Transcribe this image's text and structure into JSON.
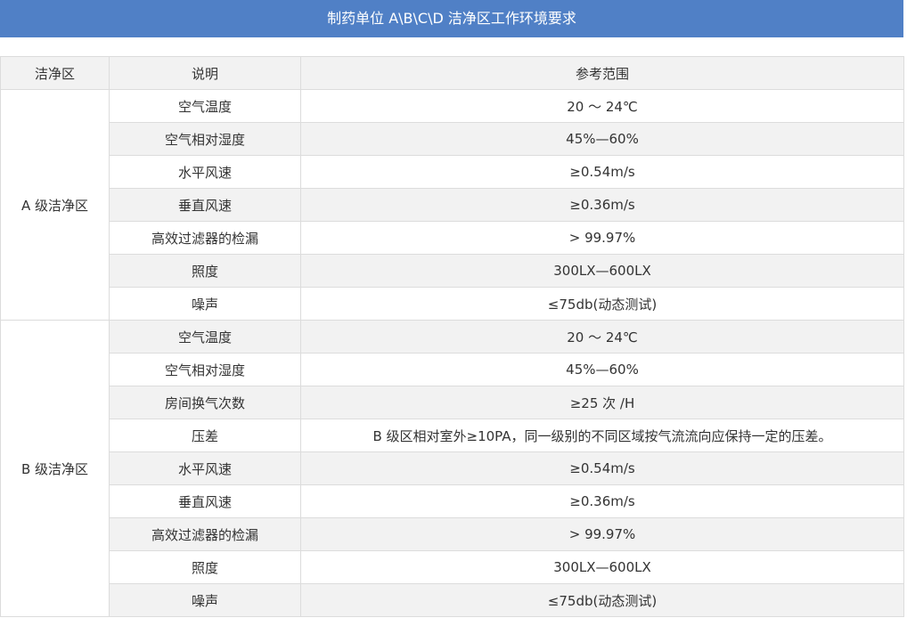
{
  "title": "制药单位 A\\B\\C\\D 洁净区工作环境要求",
  "table": {
    "headers": [
      "洁净区",
      "说明",
      "参考范围"
    ],
    "groups": [
      {
        "zone": "A 级洁净区",
        "rows": [
          {
            "item": "空气温度",
            "range": "20 ～ 24℃"
          },
          {
            "item": "空气相对湿度",
            "range": "45%—60%"
          },
          {
            "item": "水平风速",
            "range": "≥0.54m/s"
          },
          {
            "item": "垂直风速",
            "range": "≥0.36m/s"
          },
          {
            "item": "高效过滤器的检漏",
            "range": "> 99.97%"
          },
          {
            "item": "照度",
            "range": "300LX—600LX"
          },
          {
            "item": "噪声",
            "range": "≤75db(动态测试)"
          }
        ]
      },
      {
        "zone": "B 级洁净区",
        "rows": [
          {
            "item": "空气温度",
            "range": "20 ～ 24℃"
          },
          {
            "item": "空气相对湿度",
            "range": "45%—60%"
          },
          {
            "item": "房间换气次数",
            "range": "≥25 次 /H"
          },
          {
            "item": "压差",
            "range": "B 级区相对室外≥10PA，同一级别的不同区域按气流流向应保持一定的压差。"
          },
          {
            "item": "水平风速",
            "range": "≥0.54m/s"
          },
          {
            "item": "垂直风速",
            "range": "≥0.36m/s"
          },
          {
            "item": "高效过滤器的检漏",
            "range": "> 99.97%"
          },
          {
            "item": "照度",
            "range": "300LX—600LX"
          },
          {
            "item": "噪声",
            "range": "≤75db(动态测试)"
          }
        ]
      }
    ]
  }
}
